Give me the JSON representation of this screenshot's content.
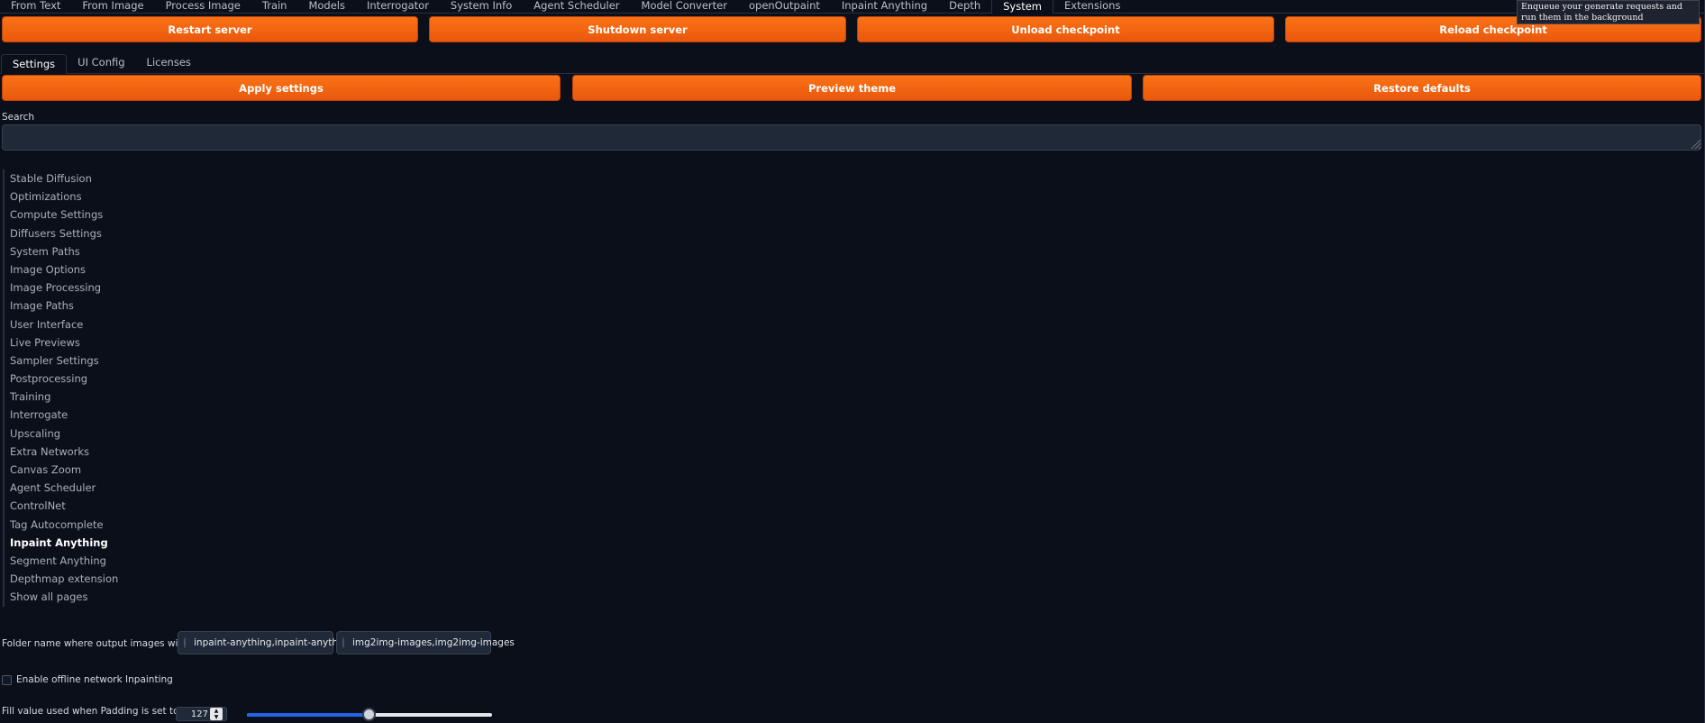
{
  "top_tabs": [
    {
      "label": "From Text"
    },
    {
      "label": "From Image"
    },
    {
      "label": "Process Image"
    },
    {
      "label": "Train"
    },
    {
      "label": "Models"
    },
    {
      "label": "Interrogator"
    },
    {
      "label": "System Info"
    },
    {
      "label": "Agent Scheduler"
    },
    {
      "label": "Model Converter"
    },
    {
      "label": "openOutpaint"
    },
    {
      "label": "Inpaint Anything"
    },
    {
      "label": "Depth"
    },
    {
      "label": "System"
    },
    {
      "label": "Extensions"
    }
  ],
  "tooltip": "Enqueue your generate requests and run them in the background",
  "server_buttons": {
    "restart": "Restart server",
    "shutdown": "Shutdown server",
    "unload": "Unload checkpoint",
    "reload": "Reload checkpoint"
  },
  "sub_tabs": [
    {
      "label": "Settings"
    },
    {
      "label": "UI Config"
    },
    {
      "label": "Licenses"
    }
  ],
  "settings_buttons": {
    "apply": "Apply settings",
    "preview": "Preview theme",
    "restore": "Restore defaults"
  },
  "search": {
    "label": "Search",
    "value": "",
    "placeholder": ""
  },
  "categories": [
    {
      "label": "Stable Diffusion"
    },
    {
      "label": "Optimizations"
    },
    {
      "label": "Compute Settings"
    },
    {
      "label": "Diffusers Settings"
    },
    {
      "label": "System Paths"
    },
    {
      "label": "Image Options"
    },
    {
      "label": "Image Processing"
    },
    {
      "label": "Image Paths"
    },
    {
      "label": "User Interface"
    },
    {
      "label": "Live Previews"
    },
    {
      "label": "Sampler Settings"
    },
    {
      "label": "Postprocessing"
    },
    {
      "label": "Training"
    },
    {
      "label": "Interrogate"
    },
    {
      "label": "Upscaling"
    },
    {
      "label": "Extra Networks"
    },
    {
      "label": "Canvas Zoom"
    },
    {
      "label": "Agent Scheduler"
    },
    {
      "label": "ControlNet"
    },
    {
      "label": "Tag Autocomplete"
    },
    {
      "label": "Inpaint Anything"
    },
    {
      "label": "Segment Anything"
    },
    {
      "label": "Depthmap extension"
    },
    {
      "label": "Show all pages"
    }
  ],
  "active_category": "Inpaint Anything",
  "output_folder": {
    "label": "Folder name where output images will be saved",
    "options": [
      "inpaint-anything,inpaint-anything",
      "img2img-images,img2img-images"
    ]
  },
  "offline_inpainting": {
    "label": "Enable offline network Inpainting",
    "checked": false
  },
  "padding_fill": {
    "label": "Fill value used when Padding is set to constant",
    "value": "127",
    "min": 0,
    "max": 255
  },
  "colors": {
    "background": "#0b0f19",
    "accent": "#f97316",
    "slider_fill": "#2563eb"
  }
}
